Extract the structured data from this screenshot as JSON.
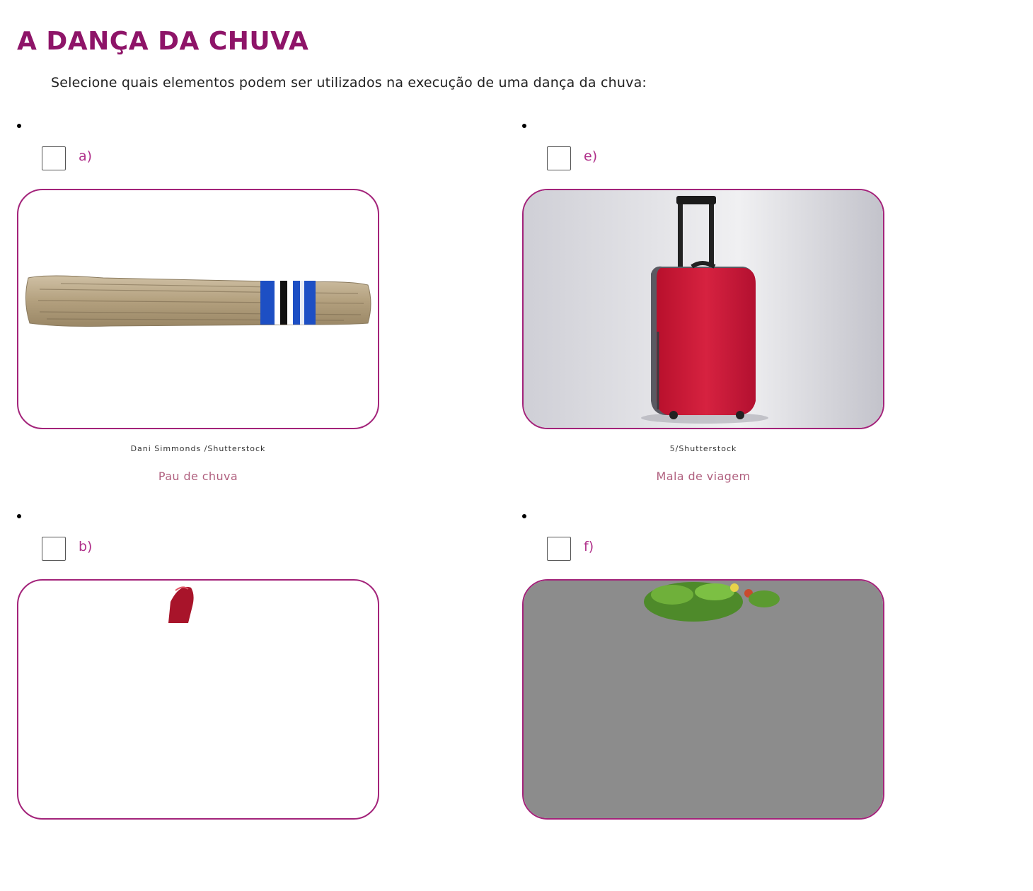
{
  "page": {
    "title": "A DANÇA DA CHUVA",
    "instruction": "Selecione quais elementos podem ser utilizados na execução de uma dança da chuva:"
  },
  "options": [
    {
      "letter": "a)",
      "credit": "Dani Simmonds /Shutterstock",
      "caption": "Pau de chuva",
      "image": "rain-stick-image"
    },
    {
      "letter": "e)",
      "credit": "5/Shutterstock",
      "caption": "Mala de viagem",
      "image": "suitcase-image"
    },
    {
      "letter": "b)",
      "image": "red-object-image"
    },
    {
      "letter": "f)",
      "image": "plant-image"
    }
  ],
  "colors": {
    "title": "#8e1468",
    "accent": "#a3237a",
    "label": "#b0308a",
    "caption": "#b0607f"
  }
}
